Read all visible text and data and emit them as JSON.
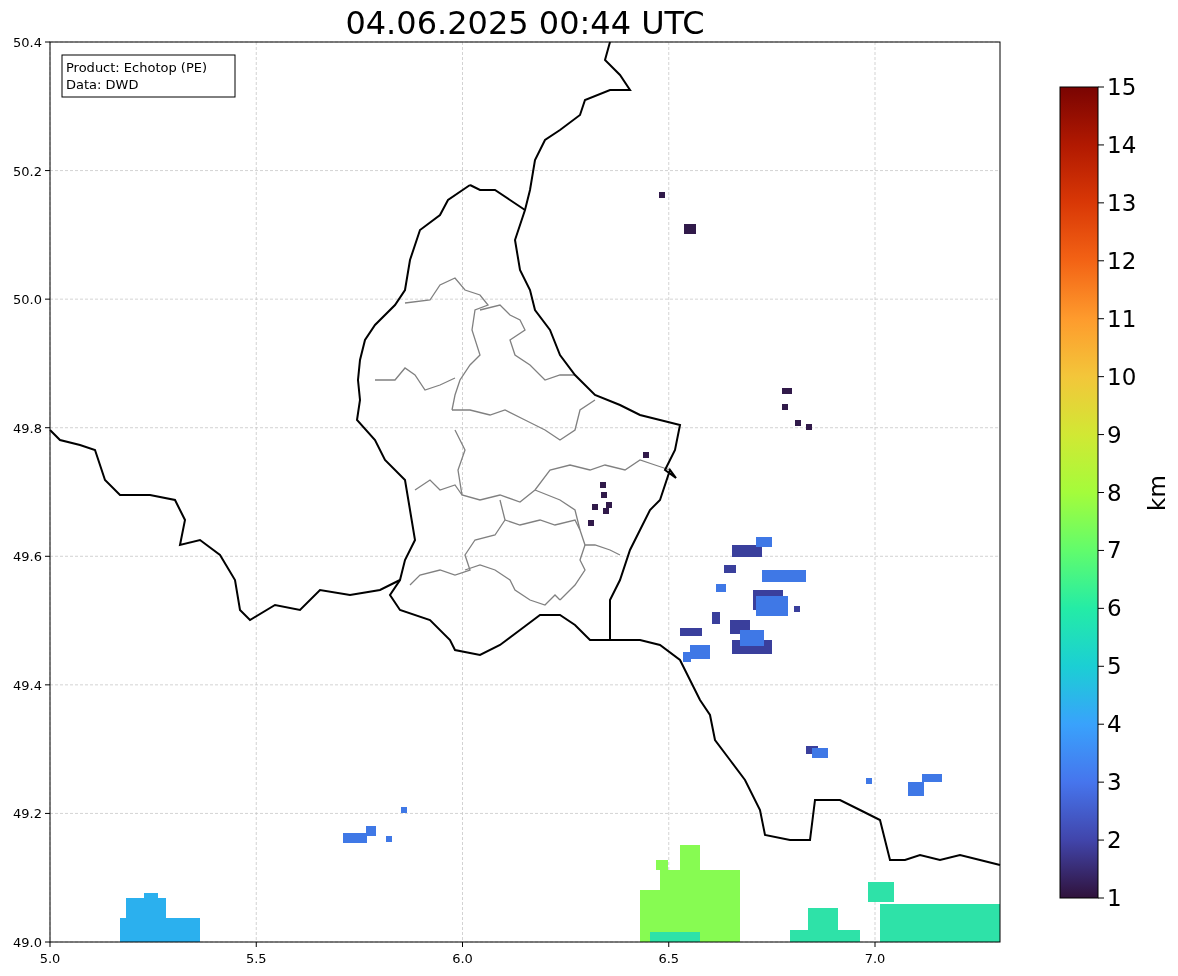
{
  "title": "04.06.2025 00:44 UTC",
  "info_box": [
    "Product: Echotop (PE)",
    "Data: DWD"
  ],
  "x_ticks": [
    "5.0",
    "5.5",
    "6.0",
    "6.5",
    "7.0"
  ],
  "y_ticks": [
    "50.4",
    "50.2",
    "50.0",
    "49.8",
    "49.6",
    "49.4",
    "49.2",
    "49.0"
  ],
  "colorbar": {
    "label": "km",
    "ticks": [
      "15",
      "14",
      "13",
      "12",
      "11",
      "10",
      "9",
      "8",
      "7",
      "6",
      "5",
      "4",
      "3",
      "2",
      "1"
    ]
  }
}
